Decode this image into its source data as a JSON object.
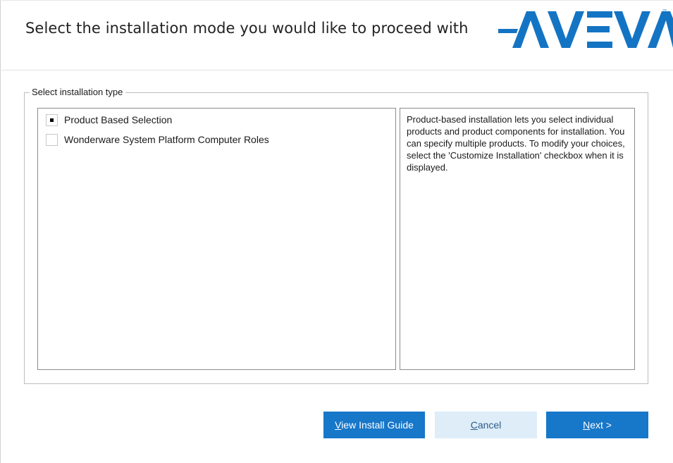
{
  "header": {
    "title": "Select the installation mode you would like to proceed with",
    "logo_text": "AVEVA",
    "logo_tm": "™",
    "brand_color": "#1474c4"
  },
  "install_type": {
    "legend": "Select installation type",
    "items": [
      {
        "label": "Product Based Selection",
        "checked": true
      },
      {
        "label": "Wonderware System Platform Computer Roles",
        "checked": false
      }
    ],
    "description": "Product-based installation lets you select individual products and product components for installation. You can specify multiple products. To modify your choices, select the 'Customize Installation' checkbox when it is displayed."
  },
  "buttons": {
    "guide": {
      "mnemonic": "V",
      "rest": "iew Install Guide"
    },
    "cancel": {
      "mnemonic": "C",
      "rest": "ancel"
    },
    "next": {
      "mnemonic": "N",
      "rest": "ext >"
    }
  },
  "colors": {
    "primary_button": "#1777c9",
    "secondary_button": "#deedf8"
  }
}
